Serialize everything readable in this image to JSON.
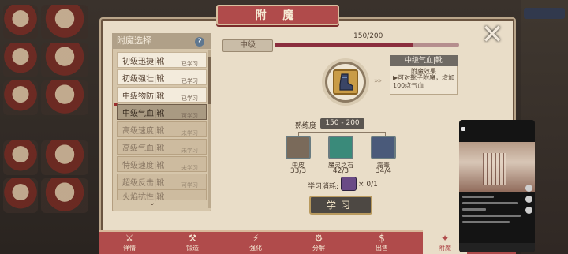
{
  "window": {
    "title": "附 魔"
  },
  "list": {
    "header": "附魔选择",
    "items": [
      {
        "name": "初级迅捷|靴",
        "status": "已学习",
        "state": "learned"
      },
      {
        "name": "初级强壮|靴",
        "status": "已学习",
        "state": "learned"
      },
      {
        "name": "中级物防|靴",
        "status": "已学习",
        "state": "learned"
      },
      {
        "name": "中级气血|靴",
        "status": "可学习",
        "state": "selected"
      },
      {
        "name": "高级速度|靴",
        "status": "未学习",
        "state": "locked"
      },
      {
        "name": "高级气血|靴",
        "status": "未学习",
        "state": "locked"
      },
      {
        "name": "特级速度|靴",
        "status": "未学习",
        "state": "locked"
      },
      {
        "name": "超级反击|靴",
        "status": "可学习",
        "state": "locked"
      },
      {
        "name": "火焰抗性|靴",
        "status": "",
        "state": "locked"
      }
    ]
  },
  "progress": {
    "level": "中级",
    "text": "150/200",
    "fraction": 0.75
  },
  "info": {
    "title": "中级气血|靴",
    "subtitle": "附魔效果",
    "desc": "▶可对靴子附魔，增加100点气血"
  },
  "proficiency": {
    "label": "熟练度",
    "value": "150 - 200"
  },
  "materials": [
    {
      "name": "中皮",
      "count": "33/3",
      "icon": "leather-icon",
      "color": "#7a6a5a"
    },
    {
      "name": "魔灵之石",
      "count": "42/3",
      "icon": "magic-stone-icon",
      "color": "#3a8a7a"
    },
    {
      "name": "霜毒",
      "count": "34/4",
      "icon": "frost-poison-icon",
      "color": "#4a5a7a"
    }
  ],
  "cost": {
    "label": "学习消耗:",
    "value": "× 0/1",
    "icon": "enchant-book-icon"
  },
  "learn_button": "学习",
  "tabs": [
    {
      "label": "详情",
      "icon": "detail-icon"
    },
    {
      "label": "锻造",
      "icon": "forge-icon"
    },
    {
      "label": "强化",
      "icon": "strengthen-icon"
    },
    {
      "label": "分解",
      "icon": "decompose-icon"
    },
    {
      "label": "出售",
      "icon": "sell-icon"
    },
    {
      "label": "附魔",
      "icon": "enchant-icon",
      "active": true
    }
  ],
  "colors": {
    "accent": "#b04b4b",
    "panel": "#e9ddc8",
    "progress": "#8b2e3e"
  }
}
